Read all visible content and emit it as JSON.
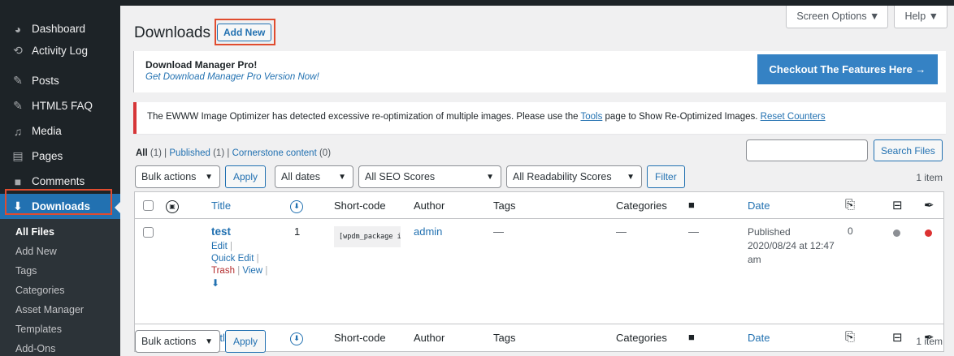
{
  "sidebar": {
    "items": [
      {
        "label": "Dashboard",
        "icon": "dashboard-icon",
        "glyph": "🎨"
      },
      {
        "label": "Activity Log",
        "icon": "history-icon",
        "glyph": "⟲"
      },
      {
        "label": "Posts",
        "icon": "pin-icon",
        "glyph": "📌"
      },
      {
        "label": "HTML5 FAQ",
        "icon": "pin-icon",
        "glyph": "📌"
      },
      {
        "label": "Media",
        "icon": "media-icon",
        "glyph": "🎞"
      },
      {
        "label": "Pages",
        "icon": "page-icon",
        "glyph": "▤"
      },
      {
        "label": "Comments",
        "icon": "comment-icon",
        "glyph": "💬"
      },
      {
        "label": "Downloads",
        "icon": "download-icon",
        "glyph": "⬇"
      }
    ],
    "submenu": [
      "All Files",
      "Add New",
      "Tags",
      "Categories",
      "Asset Manager",
      "Templates",
      "Add-Ons"
    ]
  },
  "header": {
    "title": "Downloads",
    "add_new": "Add New",
    "screen_options": "Screen Options ▼",
    "help": "Help ▼"
  },
  "promo": {
    "title": "Download Manager Pro!",
    "link": "Get Download Manager Pro Version Now!",
    "button": "Checkout The Features Here →"
  },
  "notice": {
    "text_before": "The EWWW Image Optimizer has detected excessive re-optimization of multiple images. Please use the ",
    "tools_link": "Tools",
    "text_after": " page to Show Re-Optimized Images. ",
    "reset_link": "Reset Counters"
  },
  "views": {
    "all": "All",
    "all_count": "(1)",
    "published": "Published",
    "published_count": "(1)",
    "cornerstone": "Cornerstone content",
    "cornerstone_count": "(0)",
    "sep": "|"
  },
  "search": {
    "button": "Search Files"
  },
  "filters": {
    "bulk_actions": "Bulk actions",
    "apply": "Apply",
    "dates": "All dates",
    "seo": "All SEO Scores",
    "readability": "All Readability Scores",
    "filter": "Filter",
    "item_count": "1 item"
  },
  "table": {
    "columns": {
      "title": "Title",
      "shortcode": "Short-code",
      "author": "Author",
      "tags": "Tags",
      "categories": "Categories",
      "date": "Date"
    },
    "row": {
      "title": "test",
      "downloads": "1",
      "shortcode": "[wpdm_package id='",
      "author": "admin",
      "tags": "—",
      "categories": "—",
      "comments": "—",
      "date_status": "Published",
      "date_value": "2020/08/24 at 12:47 am",
      "links": "0",
      "edit": "Edit",
      "quick_edit": "Quick Edit",
      "trash": "Trash",
      "view": "View",
      "seo_color": "#8c8f94",
      "readability_color": "#dc3232"
    }
  }
}
